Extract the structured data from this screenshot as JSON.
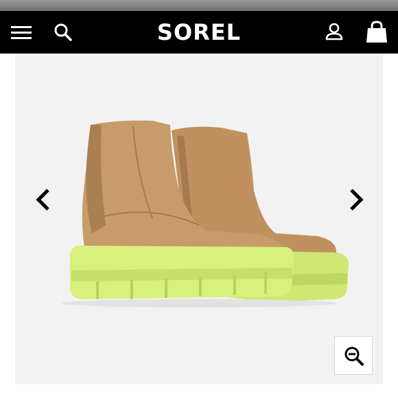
{
  "header": {
    "brand": "SOREL",
    "icons": [
      "menu-icon",
      "search-icon",
      "account-icon",
      "shopping-bag-icon"
    ]
  },
  "gallery": {
    "icons": [
      "chevron-left-icon",
      "chevron-right-icon",
      "zoom-in-icon"
    ],
    "product_colors": {
      "upper": "#c79a6c",
      "sole": "#d6f07a"
    }
  },
  "colors": {
    "header_bg": "#000000",
    "gallery_bg": "#f2f2f2"
  }
}
